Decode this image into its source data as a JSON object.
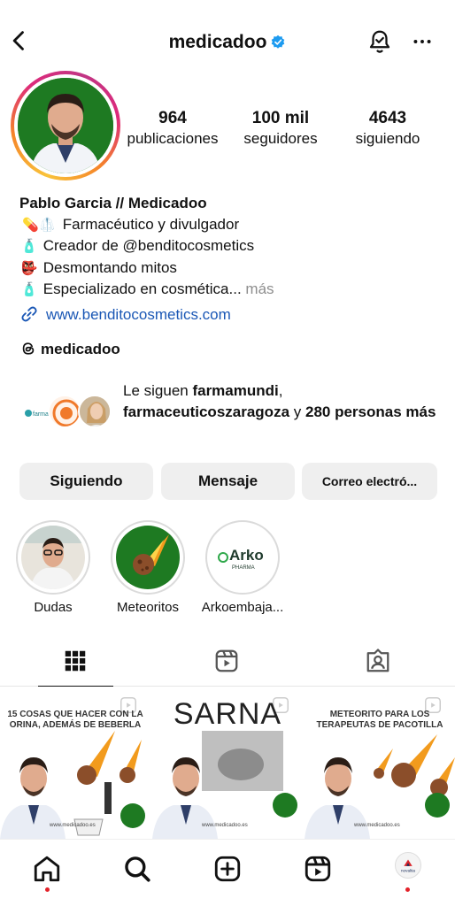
{
  "header": {
    "username": "medicadoo",
    "back_icon": "chevron-left-icon",
    "verified_icon": "verified-badge-icon",
    "notification_icon": "bell-check-icon",
    "more_icon": "more-horizontal-icon"
  },
  "stats": [
    {
      "value": "964",
      "label": "publicaciones"
    },
    {
      "value": "100 mil",
      "label": "seguidores"
    },
    {
      "value": "4643",
      "label": "siguiendo"
    }
  ],
  "bio": {
    "name": "Pablo Garcia // Medicadoo",
    "lines": [
      {
        "emoji": "💊🥼",
        "text": "Farmacéutico y divulgador"
      },
      {
        "emoji": "🧴",
        "text": "Creador de @benditocosmetics"
      },
      {
        "emoji": "👺",
        "text": "Desmontando mitos"
      },
      {
        "emoji": "🧴",
        "text": "Especializado en cosmética...",
        "more": "más"
      }
    ],
    "website": "www.benditocosmetics.com",
    "threads": "medicadoo"
  },
  "followed_by": {
    "prefix": "Le siguen ",
    "user1": "farmamundi",
    "sep": ",",
    "user2": "farmaceuticoszaragoza",
    "and": " y ",
    "others": "280 personas más",
    "fav1_label": "farmamundi"
  },
  "actions": {
    "following": "Siguiendo",
    "message": "Mensaje",
    "email": "Correo electró..."
  },
  "highlights": [
    {
      "label": "Dudas"
    },
    {
      "label": "Meteoritos"
    },
    {
      "label": "Arkoembaja...",
      "logo_main": "Arko",
      "logo_sub": "PHARMA"
    }
  ],
  "tabs": {
    "grid_icon": "grid-icon",
    "reels_icon": "reels-icon",
    "tagged_icon": "tagged-person-icon"
  },
  "posts": [
    {
      "title": "15 COSAS QUE HACER CON LA ORINA, ADEMÁS DE BEBERLA",
      "web": "www.medicadoo.es"
    },
    {
      "title": "SARNA",
      "web": "www.medicadoo.es"
    },
    {
      "title": "METEORITO PARA LOS TERAPEUTAS DE PACOTILLA",
      "web": "www.medicadoo.es"
    }
  ],
  "bottom_nav": {
    "home_icon": "home-icon",
    "search_icon": "search-icon",
    "create_icon": "add-square-icon",
    "reels_icon": "reels-icon",
    "profile_label": "novaltia"
  },
  "colors": {
    "link": "#1a57b5",
    "verified": "#1d9bf0",
    "button_bg": "#efefef",
    "avatar_bg": "#1e7a22",
    "notification_dot": "#e3222a"
  }
}
